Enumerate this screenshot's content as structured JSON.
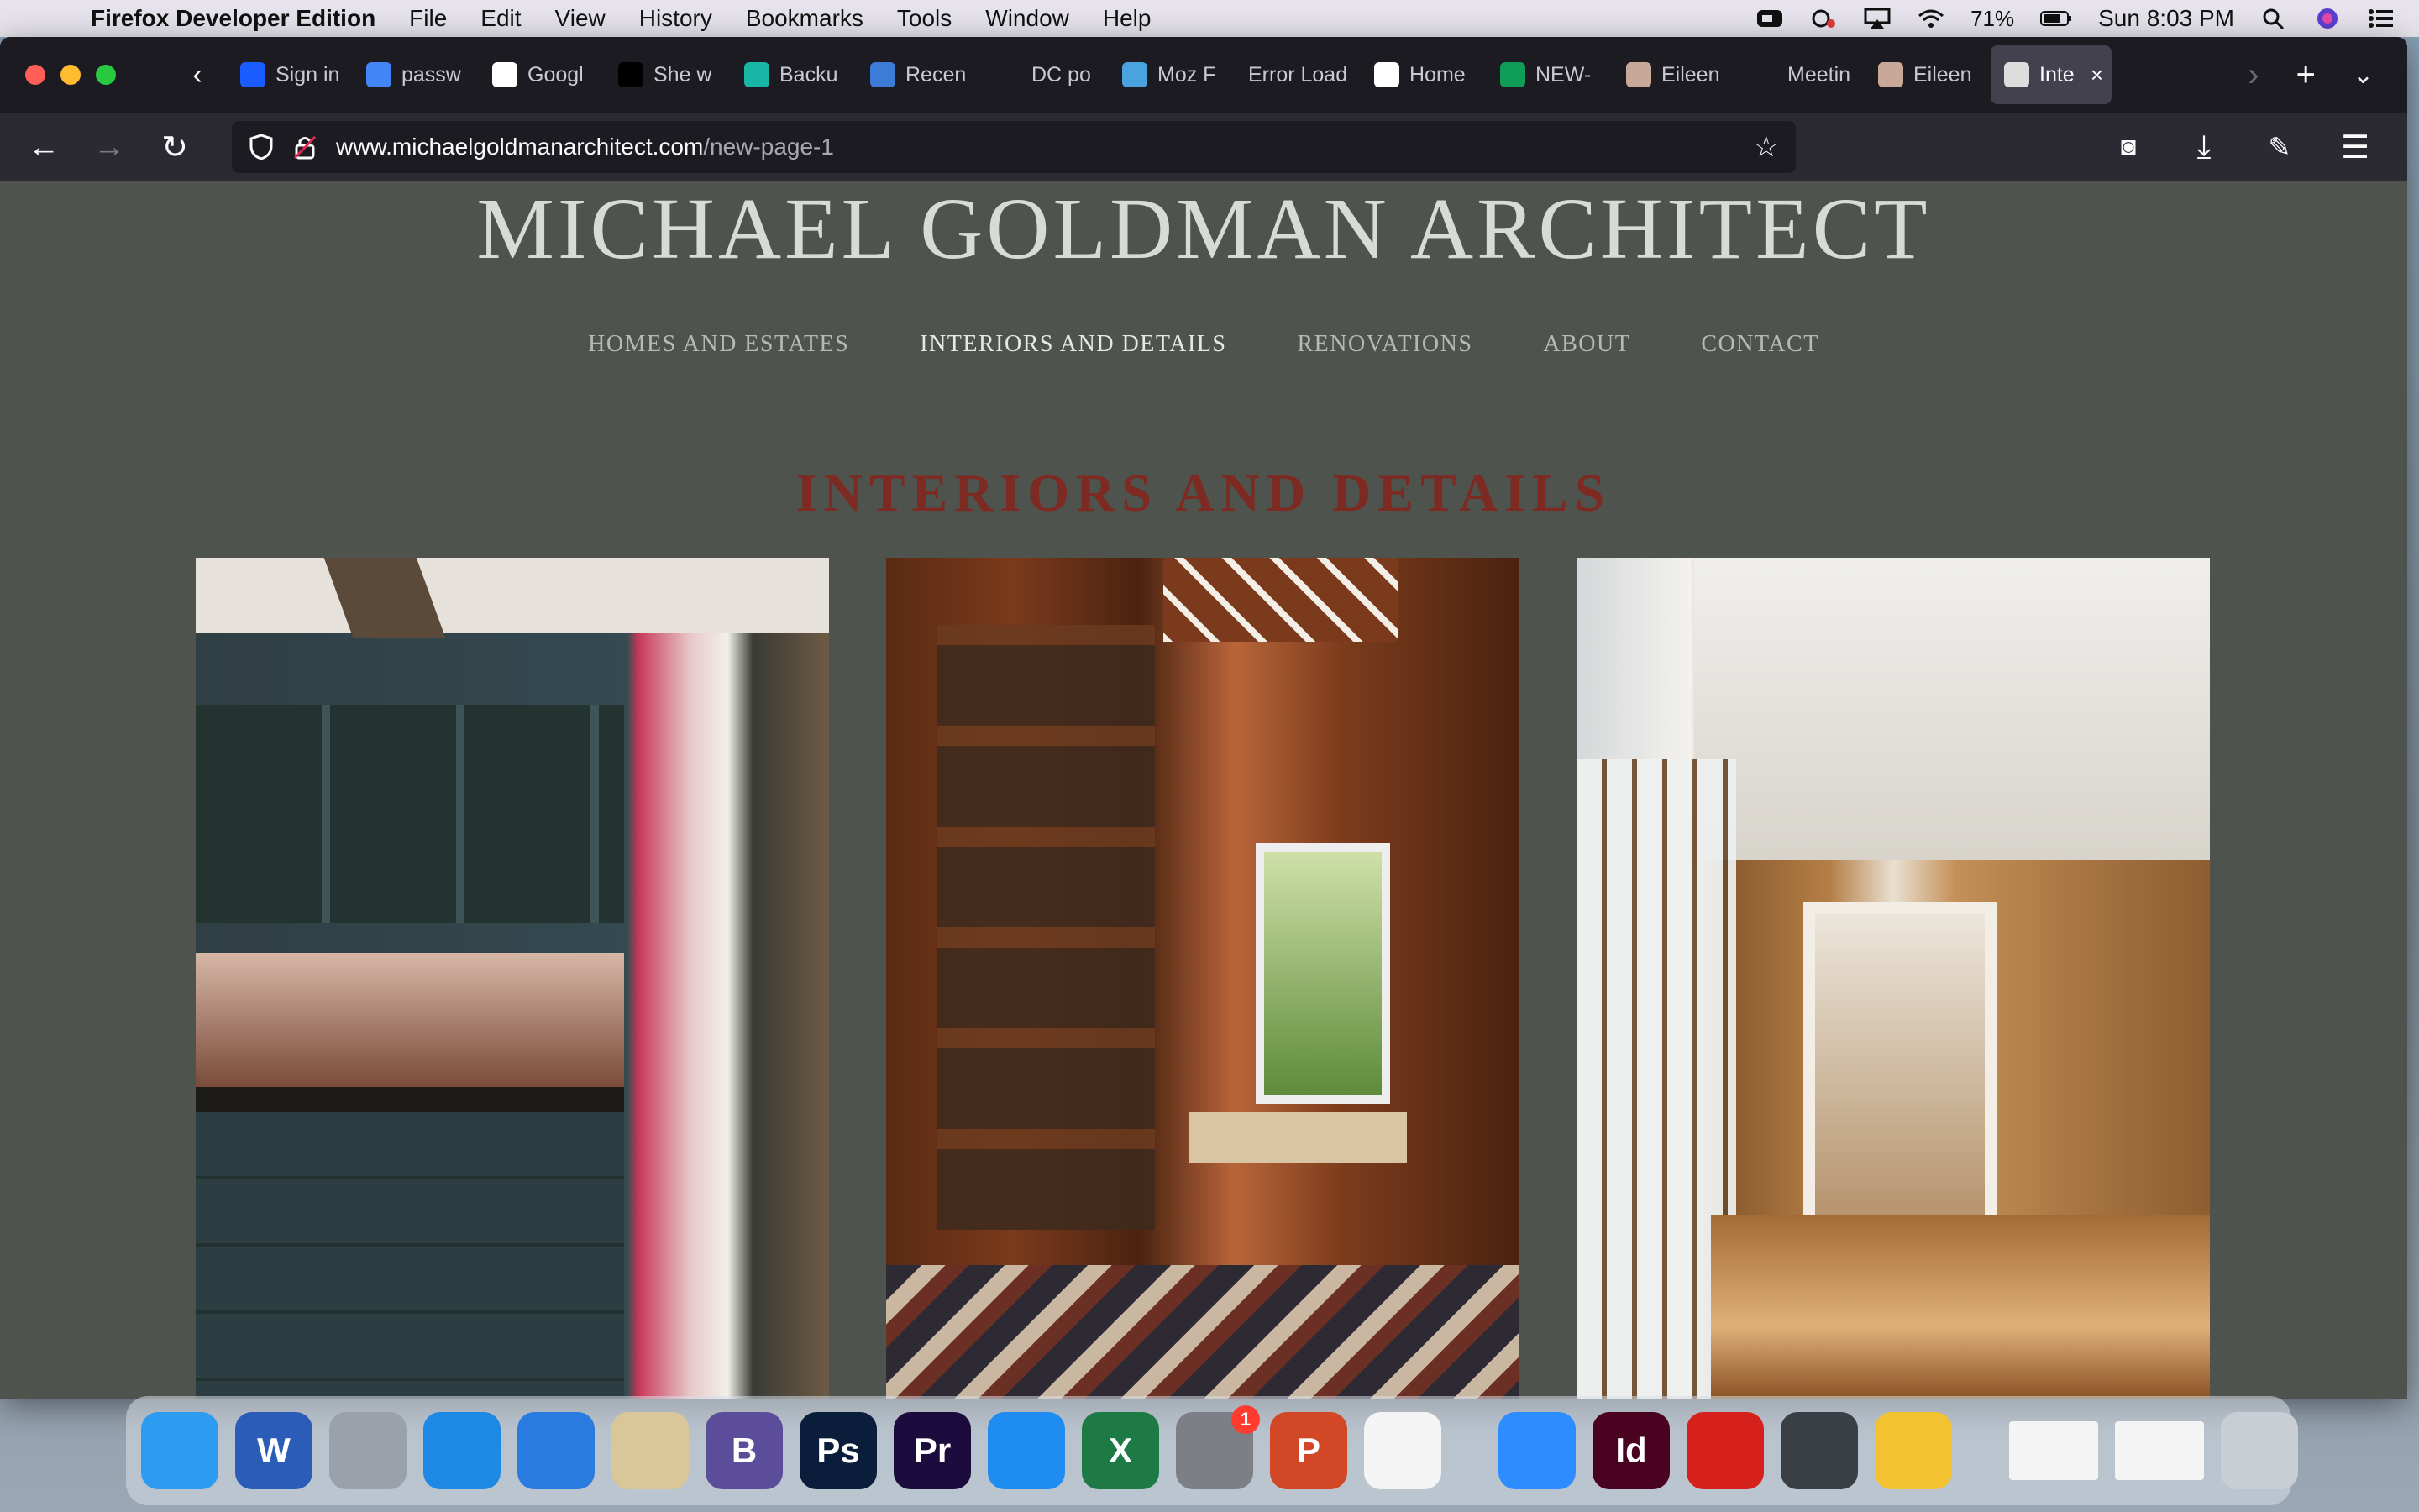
{
  "menubar": {
    "app_name": "Firefox Developer Edition",
    "menus": [
      "File",
      "Edit",
      "View",
      "History",
      "Bookmarks",
      "Tools",
      "Window",
      "Help"
    ],
    "battery": "71%",
    "clock": "Sun 8:03 PM"
  },
  "tabs": [
    {
      "label": "Sign in",
      "icon": "sign-in-favicon",
      "color": "#1a5cff"
    },
    {
      "label": "passw",
      "icon": "google-docs-favicon",
      "color": "#4285f4"
    },
    {
      "label": "Googl",
      "icon": "google-favicon",
      "color": "#ffffff"
    },
    {
      "label": "She w",
      "icon": "letter-l-favicon",
      "color": "#000000"
    },
    {
      "label": "Backu",
      "icon": "grid-favicon",
      "color": "#19b5a5"
    },
    {
      "label": "Recen",
      "icon": "pb-favicon",
      "color": "#3d7bd9"
    },
    {
      "label": "DC po",
      "icon": "dash-favicon",
      "color": "#1c1b22"
    },
    {
      "label": "Moz F",
      "icon": "moz-favicon",
      "color": "#4aa3df"
    },
    {
      "label": "Error Load",
      "icon": "none",
      "color": "#1c1b22"
    },
    {
      "label": "Home",
      "icon": "book-favicon",
      "color": "#ffffff"
    },
    {
      "label": "NEW-",
      "icon": "sheets-favicon",
      "color": "#0f9d58"
    },
    {
      "label": "Eileen",
      "icon": "avatar-favicon",
      "color": "#c8a898"
    },
    {
      "label": "Meetin",
      "icon": "big-favicon",
      "color": "#1c1b22"
    },
    {
      "label": "Eileen",
      "icon": "avatar-favicon",
      "color": "#c8a898"
    },
    {
      "label": "Inte",
      "icon": "site-favicon",
      "color": "#dddddd",
      "active": true
    }
  ],
  "urlbar": {
    "domain": "www.michaelgoldmanarchitect.com",
    "path": "/new-page-1"
  },
  "site": {
    "title": "MICHAEL GOLDMAN ARCHITECT",
    "nav": [
      {
        "label": "HOMES AND ESTATES"
      },
      {
        "label": "INTERIORS AND DETAILS",
        "current": true
      },
      {
        "label": "RENOVATIONS"
      },
      {
        "label": "ABOUT"
      },
      {
        "label": "CONTACT"
      }
    ],
    "heading": "INTERIORS AND DETAILS",
    "colors": {
      "background": "#4e534e",
      "heading": "#7d2a22"
    }
  },
  "dock": [
    {
      "icon": "finder-icon",
      "glyph": "",
      "color": "#2d9cf0"
    },
    {
      "icon": "word-icon",
      "glyph": "W",
      "color": "#2b5cb8"
    },
    {
      "icon": "launchpad-icon",
      "glyph": "",
      "color": "#9aa1aa"
    },
    {
      "icon": "safari-icon",
      "glyph": "",
      "color": "#1e88e5"
    },
    {
      "icon": "firefox-dev-icon",
      "glyph": "",
      "color": "#2a7be0"
    },
    {
      "icon": "mail-icon",
      "glyph": "",
      "color": "#d9c79a"
    },
    {
      "icon": "bbedit-icon",
      "glyph": "B",
      "color": "#5b4d9a"
    },
    {
      "icon": "photoshop-icon",
      "glyph": "Ps",
      "color": "#0a1e3c"
    },
    {
      "icon": "premiere-icon",
      "glyph": "Pr",
      "color": "#1c0b3d"
    },
    {
      "icon": "app-store-icon",
      "glyph": "",
      "color": "#1e8cf0"
    },
    {
      "icon": "excel-icon",
      "glyph": "X",
      "color": "#1d7a45"
    },
    {
      "icon": "system-preferences-icon",
      "glyph": "",
      "color": "#7c7f85",
      "badge": "1"
    },
    {
      "icon": "powerpoint-icon",
      "glyph": "P",
      "color": "#d24726"
    },
    {
      "icon": "chrome-icon",
      "glyph": "",
      "color": "#f4f4f4"
    },
    {
      "icon": "zoom-icon",
      "glyph": "",
      "color": "#2d8cff"
    },
    {
      "icon": "indesign-icon",
      "glyph": "Id",
      "color": "#49021f"
    },
    {
      "icon": "acrobat-icon",
      "glyph": "",
      "color": "#d6201b"
    },
    {
      "icon": "quicktime-icon",
      "glyph": "",
      "color": "#3a3f46"
    },
    {
      "icon": "cyberduck-icon",
      "glyph": "",
      "color": "#f2c230"
    }
  ]
}
